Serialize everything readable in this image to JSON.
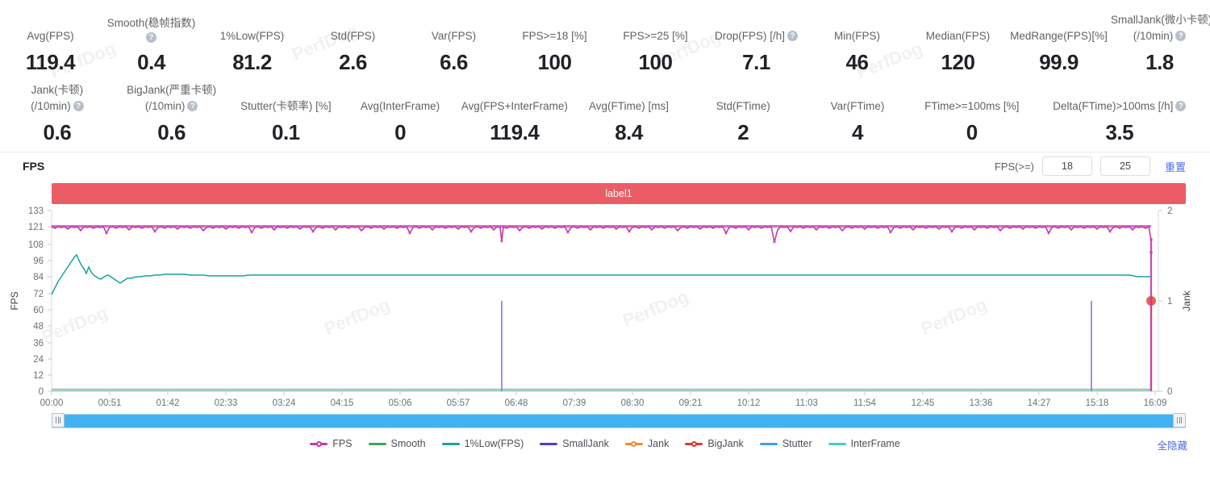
{
  "watermark": "PerfDog",
  "metrics": {
    "row1": [
      {
        "label": "Avg(FPS)",
        "value": "119.4",
        "help": false
      },
      {
        "label": "Smooth(稳帧指数)",
        "value": "0.4",
        "help": true
      },
      {
        "label": "1%Low(FPS)",
        "value": "81.2",
        "help": false
      },
      {
        "label": "Std(FPS)",
        "value": "2.6",
        "help": false
      },
      {
        "label": "Var(FPS)",
        "value": "6.6",
        "help": false
      },
      {
        "label": "FPS>=18 [%]",
        "value": "100",
        "help": false
      },
      {
        "label": "FPS>=25 [%]",
        "value": "100",
        "help": false
      },
      {
        "label": "Drop(FPS) [/h]",
        "value": "7.1",
        "help": true
      },
      {
        "label": "Min(FPS)",
        "value": "46",
        "help": false
      },
      {
        "label": "Median(FPS)",
        "value": "120",
        "help": false
      },
      {
        "label": "MedRange(FPS)[%]",
        "value": "99.9",
        "help": false
      },
      {
        "label": "SmallJank(微小卡顿)",
        "label2": "(/10min)",
        "value": "1.8",
        "help": true
      }
    ],
    "row2": [
      {
        "label": "Jank(卡顿)",
        "label2": "(/10min)",
        "value": "0.6",
        "help": true
      },
      {
        "label": "BigJank(严重卡顿)",
        "label2": "(/10min)",
        "value": "0.6",
        "help": true
      },
      {
        "label": "Stutter(卡顿率) [%]",
        "value": "0.1",
        "help": false
      },
      {
        "label": "Avg(InterFrame)",
        "value": "0",
        "help": false
      },
      {
        "label": "Avg(FPS+InterFrame)",
        "value": "119.4",
        "help": false
      },
      {
        "label": "Avg(FTime) [ms]",
        "value": "8.4",
        "help": false
      },
      {
        "label": "Std(FTime)",
        "value": "2",
        "help": false
      },
      {
        "label": "Var(FTime)",
        "value": "4",
        "help": false
      },
      {
        "label": "FTime>=100ms [%]",
        "value": "0",
        "help": false
      },
      {
        "label": "Delta(FTime)>100ms [/h]",
        "value": "3.5",
        "help": true
      }
    ]
  },
  "chart_header": {
    "title": "FPS",
    "fps_ge_label": "FPS(>=)",
    "threshold1": "18",
    "threshold2": "25",
    "reset_label": "重置"
  },
  "label_band": {
    "text": "label1",
    "color": "#ec5c66"
  },
  "slider": {
    "left_handle": "drag-handle-left",
    "right_handle": "drag-handle-right",
    "track_color": "#43b2f5"
  },
  "legend": {
    "hide_all_label": "全隐藏",
    "items": [
      {
        "name": "FPS",
        "color": "#c338b0",
        "dot": true
      },
      {
        "name": "Smooth",
        "color": "#3aa757",
        "dot": false
      },
      {
        "name": "1%Low(FPS)",
        "color": "#19a3a0",
        "dot": false
      },
      {
        "name": "SmallJank",
        "color": "#4b40c4",
        "dot": false
      },
      {
        "name": "Jank",
        "color": "#f08c32",
        "dot": true
      },
      {
        "name": "BigJank",
        "color": "#e8352e",
        "dot": true
      },
      {
        "name": "Stutter",
        "color": "#3f9ef0",
        "dot": false
      },
      {
        "name": "InterFrame",
        "color": "#3fd0d4",
        "dot": false
      }
    ]
  },
  "chart_data": {
    "type": "line",
    "title": "FPS",
    "xlabel": "",
    "ylabel": "FPS",
    "y2label": "Jank",
    "grid": false,
    "legend_position": "bottom",
    "ylim": [
      0,
      133
    ],
    "y2lim": [
      0,
      2
    ],
    "yticks": [
      0,
      12,
      24,
      36,
      48,
      60,
      72,
      84,
      96,
      108,
      121,
      133
    ],
    "y2ticks": [
      0,
      1,
      2
    ],
    "xticks": [
      "00:00",
      "00:51",
      "01:42",
      "02:33",
      "03:24",
      "04:15",
      "05:06",
      "05:57",
      "06:48",
      "07:39",
      "08:30",
      "09:21",
      "10:12",
      "11:03",
      "11:54",
      "12:45",
      "13:36",
      "14:27",
      "15:18",
      "16:09"
    ],
    "series": [
      {
        "name": "FPS",
        "color": "#c338b0",
        "axis": "left",
        "note": "near-constant ~120 with small downward spikes; sharp drop to 0 at the far right end",
        "values": [
          119,
          121,
          120,
          121,
          120,
          121,
          119,
          120,
          121,
          120,
          121,
          118,
          120,
          121,
          120,
          121,
          119,
          121,
          120,
          121,
          120,
          119,
          121,
          120,
          121,
          120,
          121,
          119,
          120,
          121,
          120,
          121,
          118,
          120,
          121,
          120,
          121,
          120,
          121,
          119,
          120,
          121,
          120,
          121,
          120,
          119,
          121,
          120,
          121,
          120,
          121,
          119,
          120,
          121,
          120,
          121,
          120,
          119,
          121,
          120,
          121,
          113,
          120,
          121,
          120,
          121,
          120,
          119,
          121,
          120,
          121,
          120,
          121,
          119,
          120,
          121,
          120,
          121,
          118,
          120,
          121,
          120,
          121,
          120,
          119,
          121,
          120,
          121,
          120,
          121,
          119,
          120,
          121,
          120,
          121,
          120,
          119,
          121,
          120,
          121,
          120,
          121,
          119,
          120,
          121,
          120,
          121,
          108,
          115,
          121,
          120,
          121,
          120,
          119,
          121,
          120,
          121,
          120,
          121,
          119,
          120,
          121,
          120,
          121,
          120,
          119,
          121,
          120,
          121,
          120,
          121,
          119,
          120,
          121,
          120,
          121,
          118,
          120,
          121,
          120,
          121,
          120,
          121,
          119,
          120,
          121,
          120,
          121,
          120,
          119,
          121,
          120,
          121,
          120,
          121,
          119,
          120,
          121,
          120,
          121,
          120,
          119,
          121,
          120,
          121,
          120,
          121,
          119,
          120,
          121,
          120,
          118,
          121,
          120,
          121,
          120,
          121,
          119,
          120,
          121,
          120,
          110,
          96,
          46,
          0
        ]
      },
      {
        "name": "1%Low(FPS)",
        "color": "#19a3a0",
        "axis": "left",
        "note": "rises quickly from ~72 to peak ~99 near 00:30 then settles around 84-87",
        "values": [
          72,
          76,
          82,
          86,
          89,
          92,
          95,
          97,
          99,
          96,
          93,
          91,
          89,
          92,
          88,
          86,
          85,
          84,
          83,
          84,
          85,
          86,
          85,
          84,
          83,
          82,
          81,
          82,
          83,
          84,
          84,
          85,
          85,
          86,
          86,
          86,
          86,
          87,
          87,
          87,
          87,
          87,
          86,
          86,
          86,
          86,
          85,
          85,
          85,
          85,
          85,
          85,
          85,
          86,
          86,
          86,
          86,
          86,
          86,
          86,
          86,
          86,
          86,
          86,
          86,
          85,
          85,
          85,
          85,
          85,
          85,
          85,
          85,
          85,
          85,
          86,
          86,
          86,
          86,
          86,
          86,
          86,
          86,
          86,
          86,
          86,
          86,
          86,
          86,
          86,
          86,
          86,
          86,
          86,
          86,
          86,
          86,
          86,
          86,
          86,
          86,
          86,
          86,
          86,
          86,
          86,
          86,
          86,
          86,
          86,
          86,
          86,
          86,
          86,
          86,
          86,
          86,
          86,
          86,
          86,
          86,
          86,
          86,
          86,
          86,
          86,
          86,
          86,
          86,
          86,
          86,
          86,
          86,
          86,
          86,
          86,
          86,
          86,
          86,
          86,
          86,
          86,
          86,
          86,
          86,
          86,
          86,
          86,
          86,
          86,
          86,
          86,
          86,
          86,
          86,
          86,
          86,
          86,
          86,
          86,
          86,
          86,
          86,
          86,
          86,
          86,
          86,
          86,
          86,
          86,
          86,
          86,
          86,
          86,
          86,
          86,
          86,
          86,
          84,
          84
        ]
      },
      {
        "name": "Smooth",
        "color": "#3aa757",
        "axis": "left",
        "note": "flat near 0 (hidden under axis)",
        "values": [
          0
        ]
      },
      {
        "name": "InterFrame",
        "color": "#3fd0d4",
        "axis": "left",
        "note": "flat at 0",
        "values": [
          0
        ]
      },
      {
        "name": "Stutter",
        "color": "#3f9ef0",
        "axis": "left",
        "note": "flat near 0",
        "values": [
          0
        ]
      },
      {
        "name": "SmallJank",
        "color": "#4b40c4",
        "axis": "right",
        "note": "impulse spikes reaching 1 at ~06:48, ~15:55 and at the right edge",
        "spikes": [
          {
            "time": "06:48",
            "value": 1
          },
          {
            "time": "15:55",
            "value": 1
          },
          {
            "time": "16:35",
            "value": 1
          }
        ]
      },
      {
        "name": "Jank",
        "color": "#f08c32",
        "axis": "right",
        "note": "single impulse at the far right edge reaching 1",
        "spikes": [
          {
            "time": "16:35",
            "value": 1
          }
        ]
      },
      {
        "name": "BigJank",
        "color": "#e8352e",
        "axis": "right",
        "note": "single impulse at the far right edge reaching 1, marked with a dot",
        "spikes": [
          {
            "time": "16:35",
            "value": 1
          }
        ]
      }
    ]
  }
}
